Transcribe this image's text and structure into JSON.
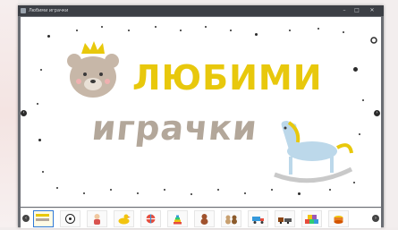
{
  "window": {
    "title": "Любими играчки"
  },
  "slide": {
    "title_line1": "ЛЮБИМИ",
    "title_line2": "играчки",
    "colors": {
      "title1": "#e8c80c",
      "title2": "#b3a79a",
      "bear": "#c7b7a8",
      "crown": "#e8c80c",
      "horse": "#bcd8ea",
      "mane": "#e8c80c"
    }
  },
  "toys": [
    {
      "name": "football-icon"
    },
    {
      "name": "doll-icon"
    },
    {
      "name": "duck-icon"
    },
    {
      "name": "ball-icon"
    },
    {
      "name": "stacking-rings-icon"
    },
    {
      "name": "teddy-bear-icon"
    },
    {
      "name": "teddies-icon"
    },
    {
      "name": "truck-icon"
    },
    {
      "name": "toy-train-icon"
    },
    {
      "name": "blocks-icon"
    },
    {
      "name": "drum-icon"
    }
  ]
}
